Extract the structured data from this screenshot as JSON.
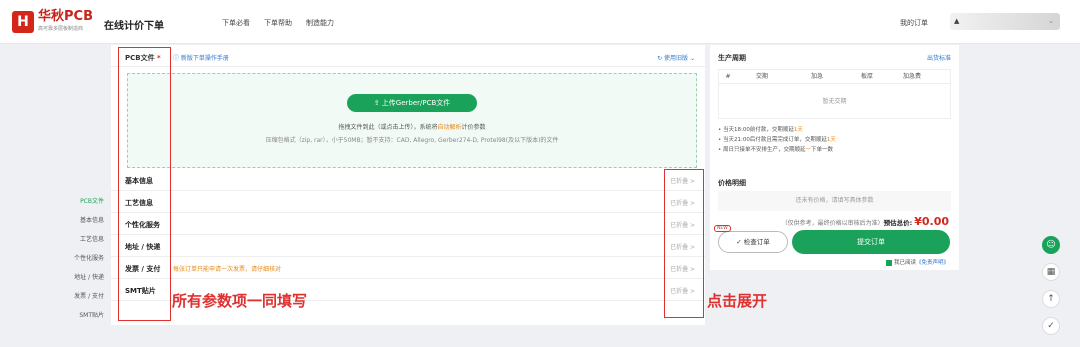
{
  "header": {
    "logo_text": "华秋PCB",
    "logo_slogan": "高可靠多层板制造商",
    "page_title": "在线计价下单",
    "nav": [
      "下单必看",
      "下单帮助",
      "制造能力"
    ],
    "my_orders": "我的订单",
    "user_name": "▲"
  },
  "left_nav": [
    "PCB文件",
    "基本信息",
    "工艺信息",
    "个性化服务",
    "地址 / 快递",
    "发票 / 支付",
    "SMT贴片"
  ],
  "pcb": {
    "title": "PCB文件",
    "required_mark": "*",
    "help": "新版下单操作手册",
    "tutorial": "使用旧版",
    "upload_button": "上传Gerber/PCB文件",
    "hint_before": "拖拽文件到此（或点击上传），系统将",
    "hint_highlight": "自动解析",
    "hint_after": "计价参数",
    "formats": "压缩包格式（zip, rar），小于50MB；暂不支持：CAD, Allegro, Gerber274-D, Protel98(及以下版本)的文件"
  },
  "sections": [
    {
      "label": "基本信息",
      "note": "",
      "expand": "已折叠 >"
    },
    {
      "label": "工艺信息",
      "note": "",
      "expand": "已折叠 >"
    },
    {
      "label": "个性化服务",
      "note": "",
      "expand": "已折叠 >"
    },
    {
      "label": "地址 / 快递",
      "note": "",
      "expand": "已折叠 >"
    },
    {
      "label": "发票 / 支付",
      "note": "每张订单只能申请一次发票，请仔细核对",
      "expand": "已折叠 >"
    },
    {
      "label": "SMT贴片",
      "note": "",
      "expand": "已折叠 >"
    }
  ],
  "annotations": {
    "left": "所有参数项一同填写",
    "right": "点击展开"
  },
  "production": {
    "title": "生产周期",
    "link": "出货标准",
    "columns": [
      "#",
      "交期",
      "加急",
      "板厚",
      "加急费"
    ],
    "empty": "暂无交期",
    "notes": [
      {
        "before": "• 当天18:00前付款，交期顺延",
        "red": "1天",
        "after": ""
      },
      {
        "before": "• 当天21:00后付款且需完成订单，交期顺延",
        "red": "1天",
        "after": ""
      },
      {
        "before": "• 周日只接单不安排生产，交期顺延",
        "red": "一",
        "after": "下单一数"
      }
    ]
  },
  "price": {
    "title": "价格明细",
    "empty": "还未有价格，请填写具体参数",
    "note": "（仅供参考，最终价格以审核后为准）",
    "total_label": "预估总价:",
    "total_value": "¥0.00",
    "check_button": "检查订单",
    "new_tag": "NEW",
    "submit_button": "提交订单",
    "agree_text": "我已阅读",
    "agree_link": "《免责声明》"
  },
  "side_tools": [
    "☺",
    "▦",
    "↑",
    "✓"
  ]
}
